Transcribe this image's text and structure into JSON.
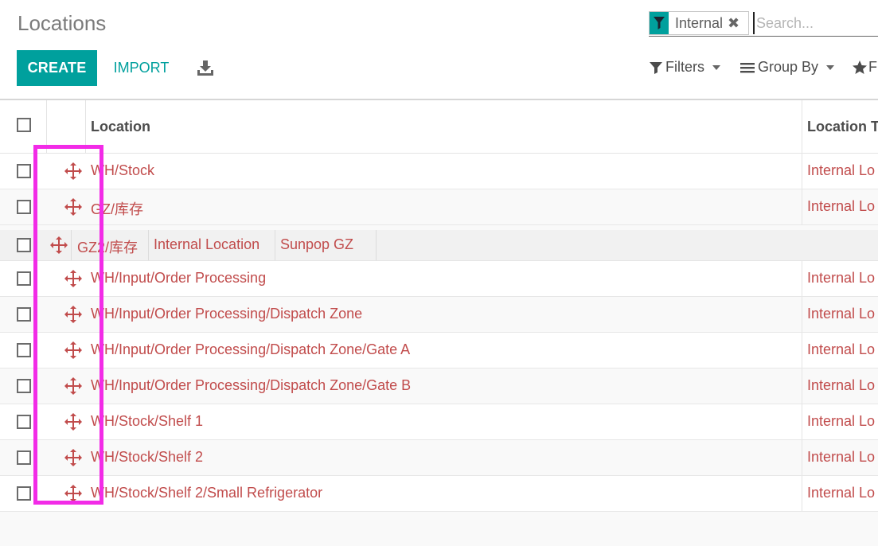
{
  "header": {
    "title": "Locations",
    "create_label": "CREATE",
    "import_label": "IMPORT"
  },
  "search": {
    "facet_label": "Internal",
    "facet_remove": "✖",
    "placeholder": "Search..."
  },
  "options": {
    "filters_label": "Filters",
    "group_by_label": "Group By",
    "favorites_label": "F"
  },
  "columns": {
    "location": "Location",
    "location_type": "Location T"
  },
  "rows": [
    {
      "name": "WH/Stock",
      "type": "Internal Lo"
    },
    {
      "name": "GZ/库存",
      "type": "Internal Lo"
    }
  ],
  "dragged_row": {
    "name": "GZ2/库存",
    "type": "Internal Location",
    "company": "Sunpop GZ"
  },
  "rows_after": [
    {
      "name": "WH/Input/Order Processing",
      "type": "Internal Lo"
    },
    {
      "name": "WH/Input/Order Processing/Dispatch Zone",
      "type": "Internal Lo"
    },
    {
      "name": "WH/Input/Order Processing/Dispatch Zone/Gate A",
      "type": "Internal Lo"
    },
    {
      "name": "WH/Input/Order Processing/Dispatch Zone/Gate B",
      "type": "Internal Lo"
    },
    {
      "name": "WH/Stock/Shelf 1",
      "type": "Internal Lo"
    },
    {
      "name": "WH/Stock/Shelf 2",
      "type": "Internal Lo"
    },
    {
      "name": "WH/Stock/Shelf 2/Small Refrigerator",
      "type": "Internal Lo"
    }
  ],
  "colors": {
    "accent": "#00a09d",
    "link": "#c14c4c",
    "highlight": "#f22be7"
  }
}
